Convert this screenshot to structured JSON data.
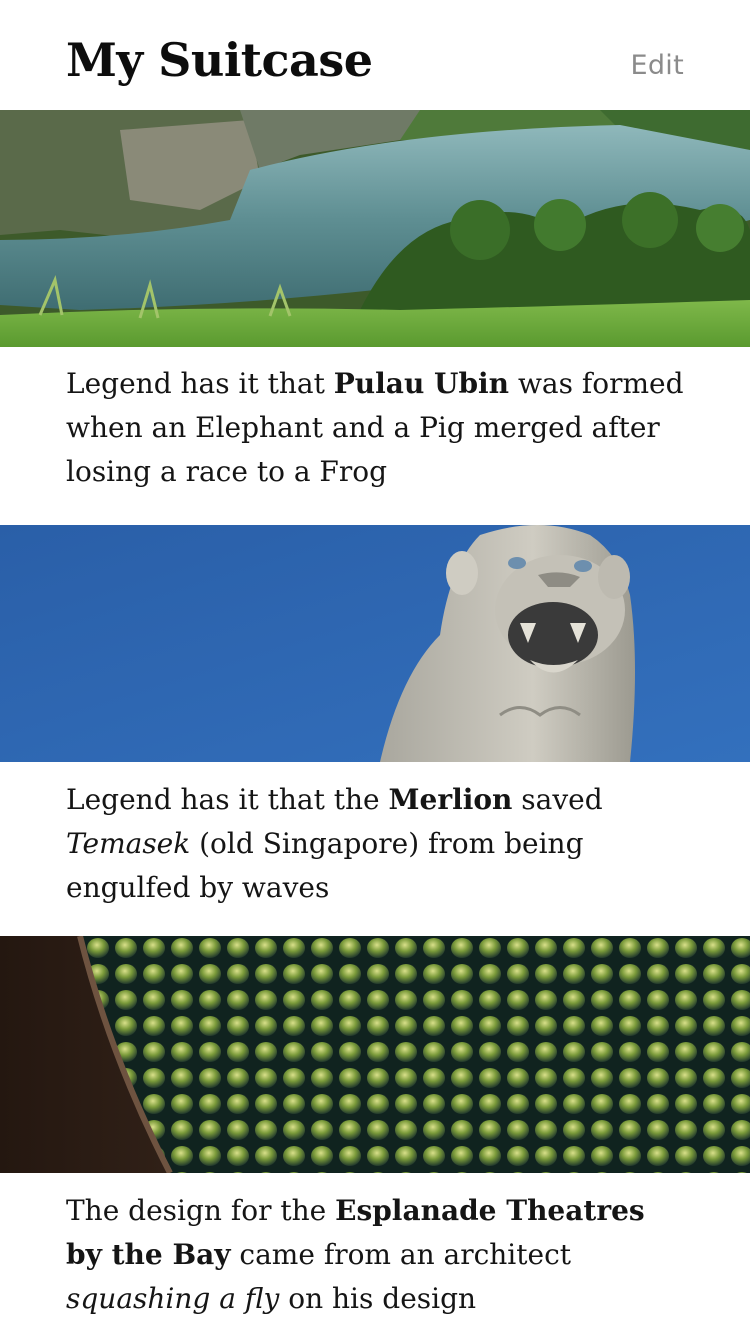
{
  "header": {
    "title": "My Suitcase",
    "edit_label": "Edit"
  },
  "cards": [
    {
      "image_icon": "lake-landscape-image",
      "text": {
        "p1": "Legend has it that ",
        "b1": "Pulau Ubin",
        "p2": " was formed when an Elephant and a Pig merged after losing a race to a Frog"
      }
    },
    {
      "image_icon": "merlion-statue-image",
      "text": {
        "p1": "Legend has it that the ",
        "b1": "Merlion",
        "p2": " saved ",
        "i1": "Temasek",
        "p3": " (old Singapore) from being engulfed by waves"
      }
    },
    {
      "image_icon": "esplanade-dome-image",
      "text": {
        "p1": "The design for the ",
        "b1": "Esplanade Theatres by the Bay",
        "p2": " came from an architect ",
        "i1": "squashing a fly",
        "p3": " on his design"
      }
    }
  ],
  "colors": {
    "sky_blue": "#2f67b3",
    "lake_water": "#5f8f93",
    "grass_green": "#5fa33a",
    "edit_gray": "#8b8b8b"
  }
}
